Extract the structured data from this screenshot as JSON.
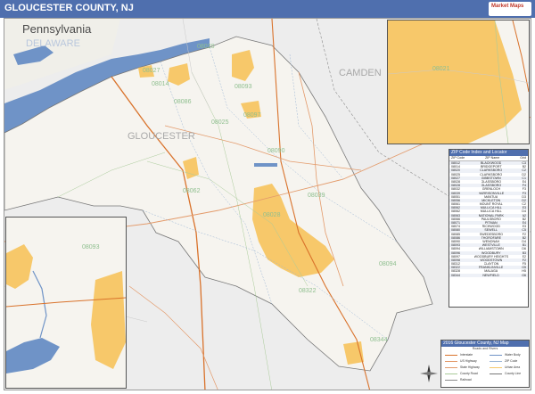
{
  "header": {
    "title": "GLOUCESTER COUNTY, NJ",
    "logo_text": "Market Maps"
  },
  "colors": {
    "title_bar": "#4f6fae",
    "water": "#6f93c7",
    "urban": "#f7c86a",
    "land": "#f6f4ef",
    "outside_land": "#ededed",
    "interstate": "#d9722b",
    "highway": "#e39a6a",
    "rail": "#8c8c8c",
    "zip_label": "#8fbf8f"
  },
  "map_labels": {
    "state_pa": "Pennsylvania",
    "county_delaware": "DELAWARE",
    "county_camden": "CAMDEN",
    "county_gloucester": "GLOUCESTER"
  },
  "zip_labels": [
    "08020",
    "08027",
    "08093",
    "08086",
    "08090",
    "08028",
    "08062",
    "08094",
    "08322",
    "08344",
    "08014",
    "08025",
    "08097",
    "08039"
  ],
  "inset_labels": [
    "08021",
    "08093"
  ],
  "zip_locator": {
    "title": "ZIP Code Index and Locator",
    "headers": [
      "ZIP Code",
      "ZIP Name",
      "Grid"
    ],
    "rows": [
      [
        "08012",
        "BLACKWOOD",
        "C3"
      ],
      [
        "08014",
        "BRIDGEPORT",
        "B2"
      ],
      [
        "08020",
        "CLARKSBORO",
        "C2"
      ],
      [
        "08025",
        "CLARKSBORO",
        "D2"
      ],
      [
        "08027",
        "GIBBSTOWN",
        "C1"
      ],
      [
        "08028",
        "GLASSBORO",
        "E4"
      ],
      [
        "08028",
        "GLASSBORO",
        "F4"
      ],
      [
        "08032",
        "GRENLOCH",
        "F3"
      ],
      [
        "08039",
        "HARRISONVILLE",
        "F3"
      ],
      [
        "08051",
        "MANTUA",
        "D3"
      ],
      [
        "08056",
        "MICKLETON",
        "D2"
      ],
      [
        "08061",
        "MOUNT ROYAL",
        "C2"
      ],
      [
        "08062",
        "MULLICA HILL",
        "E3"
      ],
      [
        "08062",
        "MULLICA HILL",
        "D4"
      ],
      [
        "08063",
        "NATIONAL PARK",
        "A2"
      ],
      [
        "08066",
        "PAULSBORO",
        "B2"
      ],
      [
        "08071",
        "PITMAN",
        "E4"
      ],
      [
        "08074",
        "RICHWOOD",
        "E3"
      ],
      [
        "08080",
        "SEWELL",
        "C5"
      ],
      [
        "08085",
        "SWEDESBORO",
        "F2"
      ],
      [
        "08086",
        "THOROFARE",
        "B2"
      ],
      [
        "08090",
        "WENONAH",
        "D4"
      ],
      [
        "08093",
        "WESTVILLE",
        "B1"
      ],
      [
        "08094",
        "WILLIAMSTOWN",
        "D6"
      ],
      [
        "08096",
        "WOODBURY",
        "B3"
      ],
      [
        "08097",
        "WOODBURY HEIGHTS",
        "E2"
      ],
      [
        "08098",
        "WOODSTOWN",
        "F2"
      ],
      [
        "08312",
        "CLAYTON",
        "F5"
      ],
      [
        "08322",
        "FRANKLINVILLE",
        "G5"
      ],
      [
        "08328",
        "MALAGA",
        "H5"
      ],
      [
        "08344",
        "NEWFIELD",
        "G6"
      ]
    ]
  },
  "map_key": {
    "title": "2016 Gloucester County, NJ Map",
    "subtitle": "Roads and Rivers",
    "items": [
      "Interstate",
      "US Highway",
      "State Highway",
      "County Road",
      "Railroad",
      "Water Body",
      "ZIP Code",
      "Urban Area",
      "County Line"
    ]
  }
}
